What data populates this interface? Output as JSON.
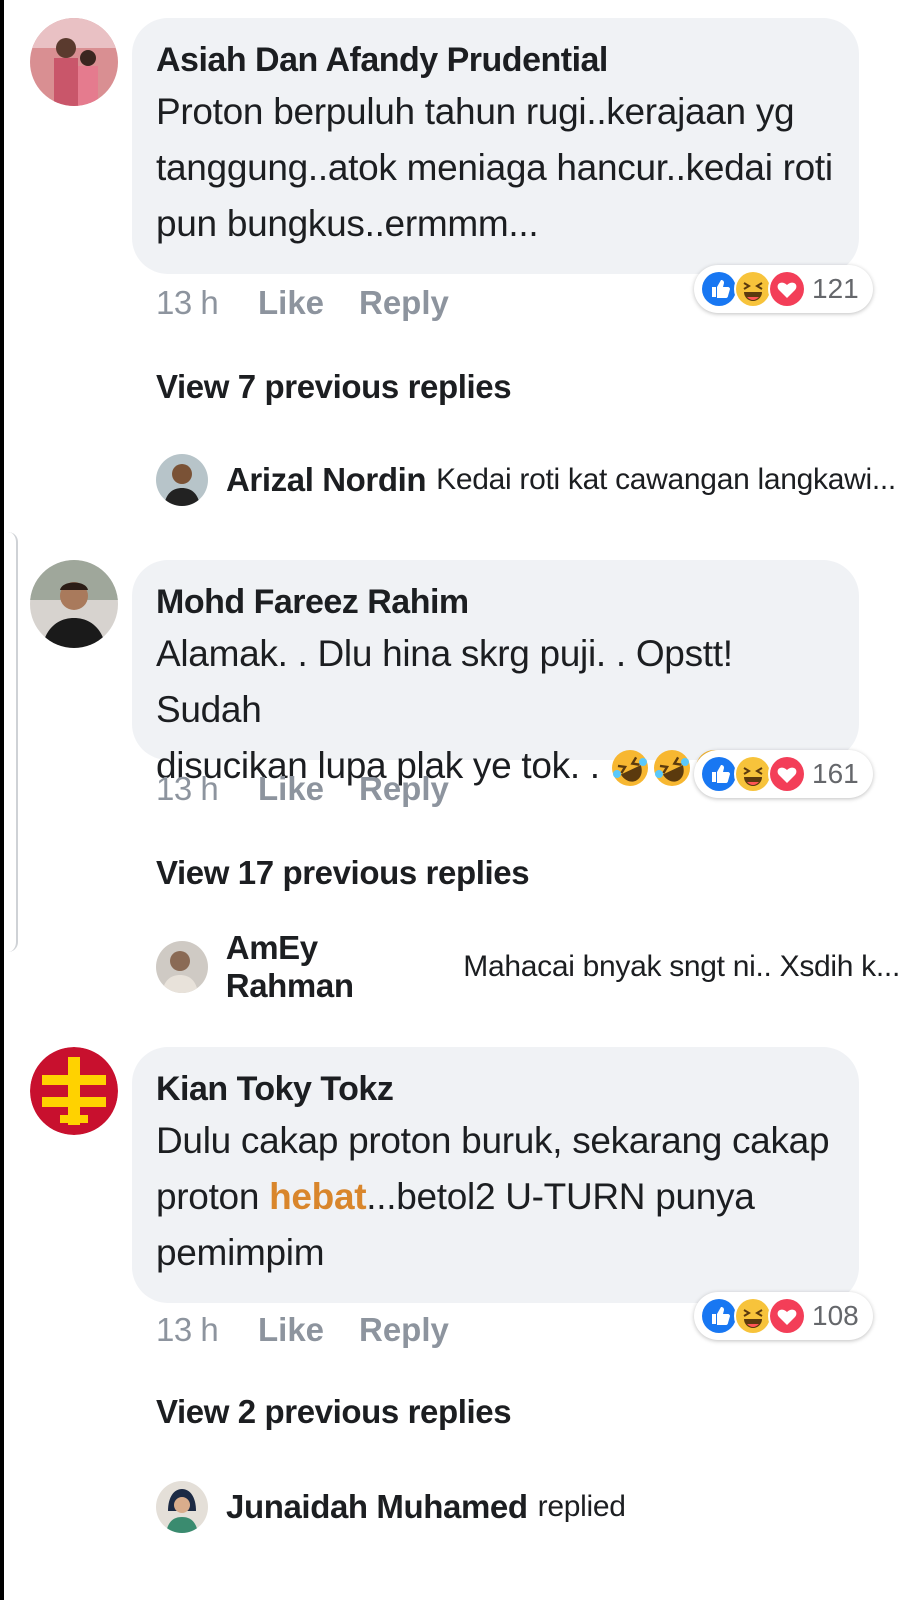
{
  "comments": [
    {
      "author": "Asiah Dan Afandy Prudential",
      "text": "Proton berpuluh tahun rugi..kerajaan yg tanggung..atok meniaga hancur..kedai roti pun bungkus..ermmm...",
      "time": "13 h",
      "like_label": "Like",
      "reply_label": "Reply",
      "reaction_count": "121",
      "reaction_icons": [
        "like-icon",
        "haha-icon",
        "love-icon"
      ],
      "view_replies": "View 7 previous replies",
      "latest_reply": {
        "author": "Arizal Nordin",
        "text": "Kedai roti kat cawangan langkawi..."
      }
    },
    {
      "author": "Mohd Fareez Rahim",
      "text_line1": "Alamak. . Dlu hina skrg puji. . Opstt! Sudah",
      "text_line2": "disucikan lupa plak ye tok. .",
      "text_emojis": [
        "rolling-laughing-emoji",
        "rolling-laughing-emoji",
        "rolling-laughing-emoji"
      ],
      "time": "13 h",
      "like_label": "Like",
      "reply_label": "Reply",
      "reaction_count": "161",
      "reaction_icons": [
        "like-icon",
        "haha-icon",
        "love-icon"
      ],
      "view_replies": "View 17 previous replies",
      "latest_reply": {
        "author": "AmEy Rahman",
        "text": "Mahacai bnyak sngt ni.. Xsdih k..."
      }
    },
    {
      "author": "Kian Toky Tokz",
      "text_before": "Dulu cakap proton buruk, sekarang cakap proton ",
      "text_link": "hebat",
      "text_after": "...betol2 U-TURN punya pemimpim",
      "time": "13 h",
      "like_label": "Like",
      "reply_label": "Reply",
      "reaction_count": "108",
      "reaction_icons": [
        "like-icon",
        "haha-icon",
        "love-icon"
      ],
      "view_replies": "View 2 previous replies",
      "latest_reply": {
        "author": "Junaidah Muhamed",
        "text": "replied"
      }
    }
  ],
  "colors": {
    "bubble": "#f0f2f5",
    "meta_text": "#8d949e",
    "link": "#d9862c",
    "like_blue": "#1877f2",
    "love_red": "#f33e58",
    "haha_yellow": "#f7c33b"
  }
}
